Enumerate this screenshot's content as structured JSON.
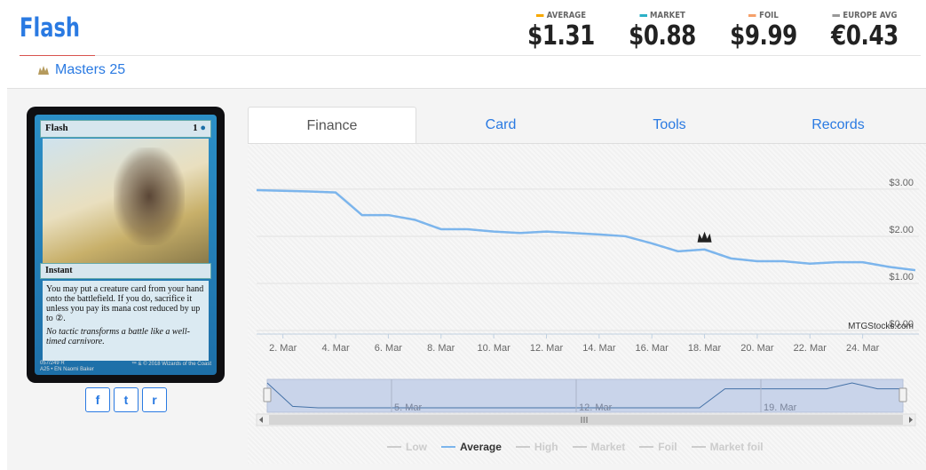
{
  "card_name": "Flash",
  "set_name": "Masters 25",
  "prices": [
    {
      "label": "AVERAGE",
      "value": "$1.31",
      "color": "#f7a800"
    },
    {
      "label": "MARKET",
      "value": "$0.88",
      "color": "#2bb0c6"
    },
    {
      "label": "FOIL",
      "value": "$9.99",
      "color": "#f5a06a"
    },
    {
      "label": "EUROPE AVG",
      "value": "€0.43",
      "color": "#999999"
    }
  ],
  "tabs": [
    "Finance",
    "Card",
    "Tools",
    "Records"
  ],
  "card_image": {
    "name": "Flash",
    "mana": "1",
    "type": "Instant",
    "rules": "You may put a creature card from your hand onto the battlefield. If you do, sacrifice it unless you pay its mana cost reduced by up to ②.",
    "flavor": "No tactic transforms a battle like a well-timed carnivore.",
    "footer1": "057/249 R",
    "footer2": "A25 • EN  Naomi Baker",
    "copyright": "™ & © 2018 Wizards of the Coast"
  },
  "social": [
    "f",
    "t",
    "r"
  ],
  "chart_data": {
    "type": "line",
    "x_ticks": [
      "2. Mar",
      "4. Mar",
      "6. Mar",
      "8. Mar",
      "10. Mar",
      "12. Mar",
      "14. Mar",
      "16. Mar",
      "18. Mar",
      "20. Mar",
      "22. Mar",
      "24. Mar"
    ],
    "y_ticks": [
      "$3.00",
      "$2.00",
      "$1.00",
      "$0.00"
    ],
    "ylim": [
      0,
      3.3
    ],
    "series": [
      {
        "name": "Average",
        "x": [
          0,
          2,
          3,
          4,
          5,
          6,
          7,
          8,
          9,
          10,
          11,
          12,
          13,
          14,
          15,
          16,
          17,
          18,
          19,
          20,
          21,
          22,
          23,
          24,
          25
        ],
        "values": [
          2.98,
          2.95,
          2.93,
          2.45,
          2.45,
          2.35,
          2.15,
          2.15,
          2.1,
          2.07,
          2.1,
          2.07,
          2.04,
          2.0,
          1.85,
          1.68,
          1.72,
          1.53,
          1.47,
          1.47,
          1.42,
          1.45,
          1.45,
          1.35,
          1.28
        ]
      }
    ],
    "watermark": "MTGStocks.com",
    "navigator_ticks": [
      "5. Mar",
      "12. Mar",
      "19. Mar"
    ],
    "legend": [
      "Low",
      "Average",
      "High",
      "Market",
      "Foil",
      "Market foil"
    ],
    "legend_active": "Average"
  }
}
